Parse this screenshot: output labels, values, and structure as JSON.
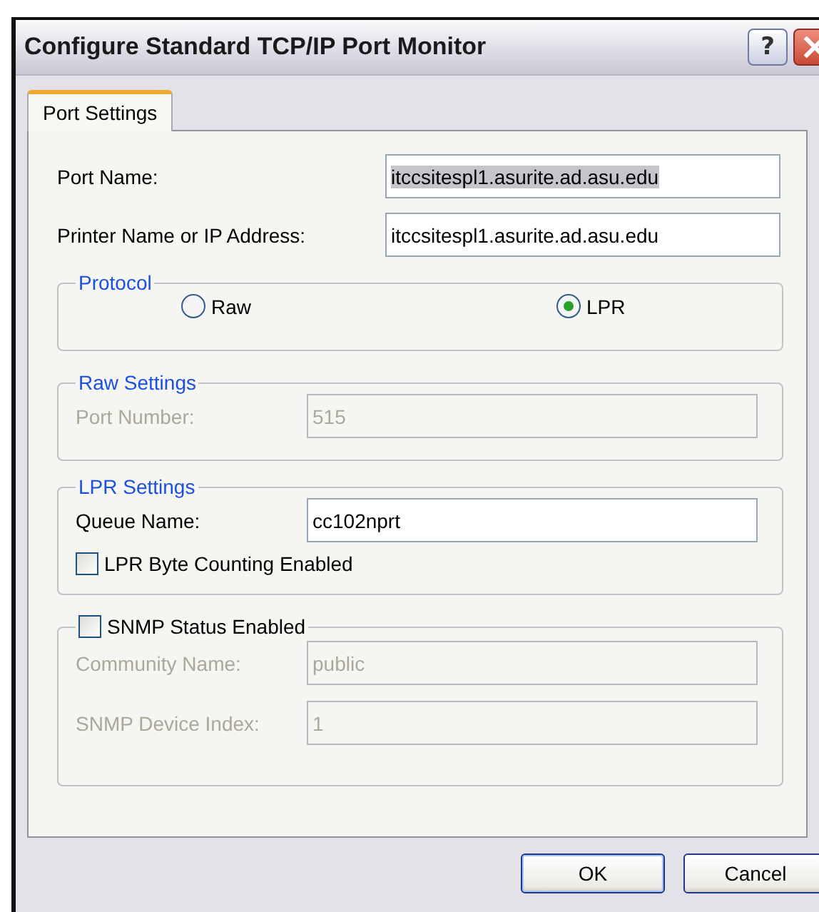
{
  "window": {
    "title": "Configure Standard TCP/IP Port Monitor",
    "help_button": "?"
  },
  "tabs": [
    {
      "label": "Port Settings",
      "selected": true
    }
  ],
  "port_fields": [
    {
      "label": "Port Name:",
      "value": "itccsitespl1.asurite.ad.asu.edu",
      "highlighted": true
    },
    {
      "label": "Printer Name or IP Address:",
      "value": "itccsitespl1.asurite.ad.asu.edu",
      "highlighted": false
    }
  ],
  "protocol": {
    "title": "Protocol",
    "options": [
      {
        "label": "Raw",
        "selected": false
      },
      {
        "label": "LPR",
        "selected": true
      }
    ]
  },
  "raw_settings": {
    "title": "Raw Settings",
    "disabled": true,
    "fields": [
      {
        "label": "Port Number:",
        "value": "515"
      }
    ]
  },
  "lpr_settings": {
    "title": "LPR Settings",
    "disabled": false,
    "fields": [
      {
        "label": "Queue Name:",
        "value": "cc102nprt"
      }
    ],
    "byte_counting": {
      "label": "LPR Byte Counting Enabled",
      "checked": false
    }
  },
  "snmp": {
    "label": "SNMP Status Enabled",
    "checked": false,
    "disabled": true,
    "fields": [
      {
        "label": "Community Name:",
        "value": "public"
      },
      {
        "label": "SNMP Device Index:",
        "value": "1"
      }
    ]
  },
  "buttons": [
    {
      "label": "OK",
      "default": true
    },
    {
      "label": "Cancel",
      "default": false
    }
  ]
}
